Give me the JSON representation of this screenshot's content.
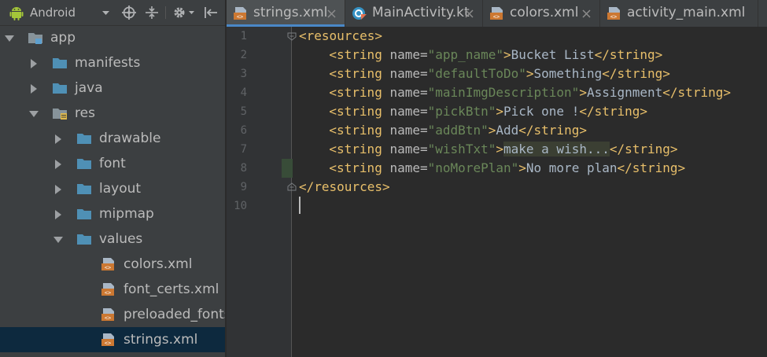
{
  "project_panel": {
    "view_label": "Android",
    "tree": [
      {
        "label": "app",
        "level": 0,
        "expanded": true,
        "icon": "module-folder-icon"
      },
      {
        "label": "manifests",
        "level": 1,
        "expanded": false,
        "icon": "folder-icon"
      },
      {
        "label": "java",
        "level": 1,
        "expanded": false,
        "icon": "folder-icon"
      },
      {
        "label": "res",
        "level": 1,
        "expanded": true,
        "icon": "resource-folder-icon"
      },
      {
        "label": "drawable",
        "level": 2,
        "expanded": false,
        "icon": "folder-icon"
      },
      {
        "label": "font",
        "level": 2,
        "expanded": false,
        "icon": "folder-icon"
      },
      {
        "label": "layout",
        "level": 2,
        "expanded": false,
        "icon": "folder-icon"
      },
      {
        "label": "mipmap",
        "level": 2,
        "expanded": false,
        "icon": "folder-icon"
      },
      {
        "label": "values",
        "level": 2,
        "expanded": true,
        "icon": "folder-icon"
      },
      {
        "label": "colors.xml",
        "level": 3,
        "icon": "xml-file-icon"
      },
      {
        "label": "font_certs.xml",
        "level": 3,
        "icon": "xml-file-icon"
      },
      {
        "label": "preloaded_fonts",
        "level": 3,
        "icon": "xml-file-icon"
      },
      {
        "label": "strings.xml",
        "level": 3,
        "icon": "xml-file-icon",
        "selected": true
      }
    ]
  },
  "tabs": [
    {
      "label": "strings.xml",
      "active": true,
      "icon": "xml-file-icon"
    },
    {
      "label": "MainActivity.kt",
      "active": false,
      "icon": "kotlin-class-icon"
    },
    {
      "label": "colors.xml",
      "active": false,
      "icon": "xml-file-icon"
    },
    {
      "label": "activity_main.xml",
      "active": false,
      "icon": "xml-file-icon"
    }
  ],
  "editor": {
    "line_numbers": [
      "1",
      "2",
      "3",
      "4",
      "5",
      "6",
      "7",
      "8",
      "9",
      "10"
    ],
    "strings": [
      {
        "name": "app_name",
        "value": "Bucket List"
      },
      {
        "name": "defaultToDo",
        "value": "Something"
      },
      {
        "name": "mainImgDescription",
        "value": "Assignment"
      },
      {
        "name": "pickBtn",
        "value": "Pick one !"
      },
      {
        "name": "addBtn",
        "value": "Add"
      },
      {
        "name": "wishTxt",
        "value": "make a wish..."
      },
      {
        "name": "noMorePlan",
        "value": "No more plan"
      }
    ],
    "open_tag": "<resources>",
    "close_tag": "</resources>",
    "string_open": "<string",
    "string_close": "</string>",
    "name_attr": "name=",
    "gt": ">"
  },
  "colors": {
    "accent": "#4a88c7",
    "selection": "#0d293e",
    "tag": "#e8bf6a",
    "value": "#6a8759",
    "text": "#a9b7c6"
  }
}
